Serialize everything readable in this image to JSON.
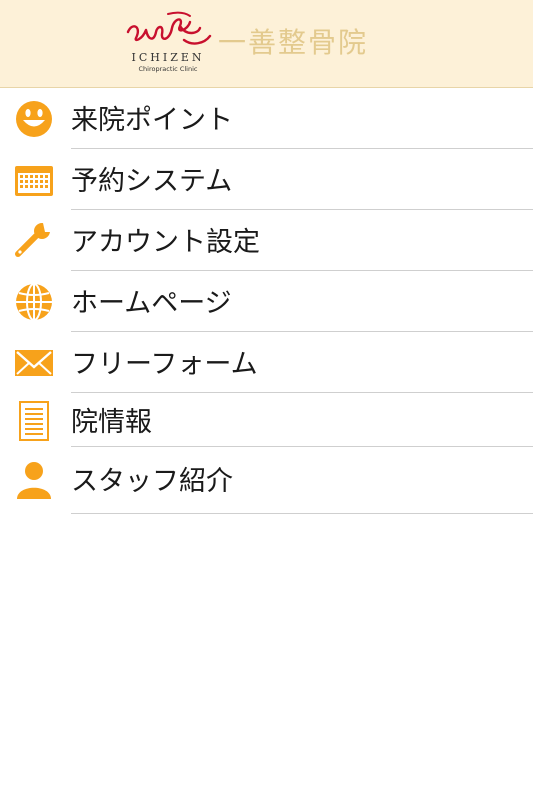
{
  "header": {
    "logo_roman": "ICHIZEN",
    "logo_sub": "Chiropractic Clinic",
    "logo_kanji": "一善整骨院"
  },
  "menu": {
    "items": [
      {
        "label": "来院ポイント",
        "icon": "smiley-icon"
      },
      {
        "label": "予約システム",
        "icon": "calendar-icon"
      },
      {
        "label": "アカウント設定",
        "icon": "wrench-icon"
      },
      {
        "label": "ホームページ",
        "icon": "globe-icon"
      },
      {
        "label": "フリーフォーム",
        "icon": "envelope-icon"
      },
      {
        "label": "院情報",
        "icon": "document-icon"
      },
      {
        "label": "スタッフ紹介",
        "icon": "person-icon"
      }
    ]
  },
  "colors": {
    "accent": "#f7a21b",
    "header_bg": "#fdf1d8",
    "logo_red": "#c8102e",
    "logo_gold": "#e3ca8e",
    "divider": "#cfcfcf"
  }
}
